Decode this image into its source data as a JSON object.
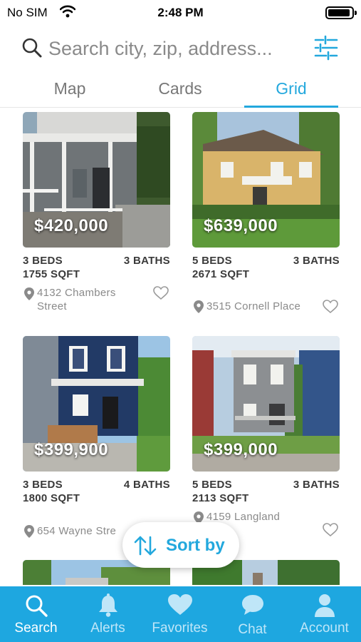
{
  "status_bar": {
    "carrier": "No SIM",
    "time": "2:48 PM"
  },
  "search": {
    "placeholder": "Search city, zip, address..."
  },
  "tabs": [
    {
      "label": "Map",
      "active": false
    },
    {
      "label": "Cards",
      "active": false
    },
    {
      "label": "Grid",
      "active": true
    }
  ],
  "listings": [
    {
      "price": "$420,000",
      "beds": "3 BEDS",
      "baths": "3 BATHS",
      "sqft": "1755 SQFT",
      "address": "4132 Chambers Street"
    },
    {
      "price": "$639,000",
      "beds": "5 BEDS",
      "baths": "3 BATHS",
      "sqft": "2671 SQFT",
      "address": "3515 Cornell Place"
    },
    {
      "price": "$399,900",
      "beds": "3 BEDS",
      "baths": "4 BATHS",
      "sqft": "1800 SQFT",
      "address": "654 Wayne Stre"
    },
    {
      "price": "$399,000",
      "beds": "5 BEDS",
      "baths": "3 BATHS",
      "sqft": "2113 SQFT",
      "address": "4159 Langland"
    }
  ],
  "sort": {
    "label": "Sort by"
  },
  "tab_bar": [
    {
      "label": "Search",
      "icon": "search-icon",
      "active": true
    },
    {
      "label": "Alerts",
      "icon": "bell-icon",
      "active": false
    },
    {
      "label": "Favorites",
      "icon": "heart-icon",
      "active": false
    },
    {
      "label": "Chat",
      "icon": "chat-bubble-icon",
      "active": false
    },
    {
      "label": "Account",
      "icon": "person-icon",
      "active": false
    }
  ],
  "colors": {
    "accent": "#23a8dd",
    "tab_bar_bg": "#1ea7e0",
    "text_muted": "#8a8a8a"
  }
}
